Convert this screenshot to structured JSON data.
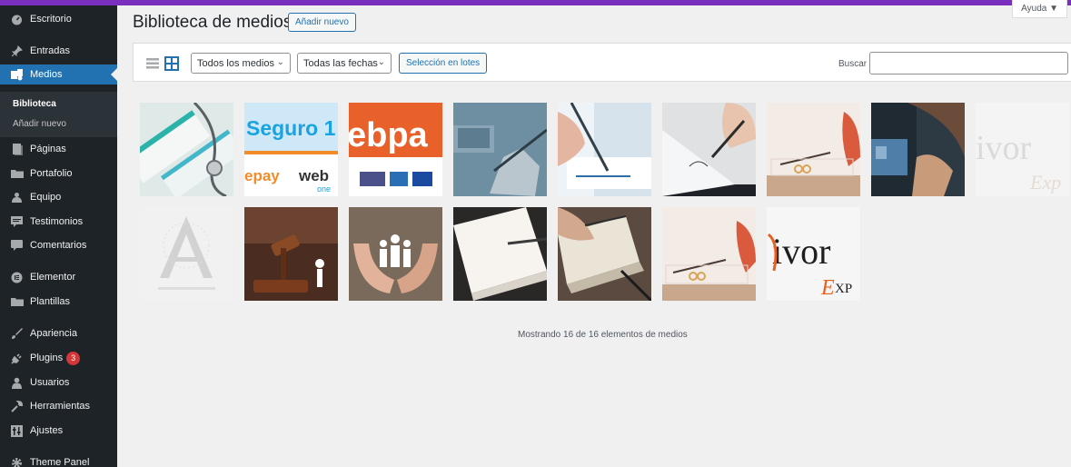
{
  "sidebar": {
    "items": [
      {
        "label": "Escritorio",
        "icon": "dashboard-icon"
      },
      {
        "label": "Entradas",
        "icon": "pin-icon"
      },
      {
        "label": "Medios",
        "icon": "media-icon"
      },
      {
        "label": "Páginas",
        "icon": "page-icon"
      },
      {
        "label": "Portafolio",
        "icon": "folder-icon"
      },
      {
        "label": "Equipo",
        "icon": "people-icon"
      },
      {
        "label": "Testimonios",
        "icon": "testimonial-icon"
      },
      {
        "label": "Comentarios",
        "icon": "comment-icon"
      },
      {
        "label": "Elementor",
        "icon": "elementor-icon"
      },
      {
        "label": "Plantillas",
        "icon": "folder-icon"
      },
      {
        "label": "Apariencia",
        "icon": "brush-icon"
      },
      {
        "label": "Plugins",
        "icon": "plug-icon",
        "badge": "3"
      },
      {
        "label": "Usuarios",
        "icon": "user-icon"
      },
      {
        "label": "Herramientas",
        "icon": "wrench-icon"
      },
      {
        "label": "Ajustes",
        "icon": "settings-icon"
      },
      {
        "label": "Theme Panel",
        "icon": "gear-icon"
      }
    ],
    "submenu": [
      "Biblioteca",
      "Añadir nuevo"
    ]
  },
  "header": {
    "title": "Biblioteca de medios",
    "add_new": "Añadir nuevo",
    "help": "Ayuda ▼"
  },
  "toolbar": {
    "filter_media": "Todos los medios",
    "filter_dates": "Todas las fechas",
    "bulk_select": "Selección en lotes",
    "search_label": "Buscar",
    "search_value": ""
  },
  "media_items": [
    {
      "type": "medical-cards"
    },
    {
      "type": "seguro-logo",
      "text": "Seguro 1"
    },
    {
      "type": "webpay-logo"
    },
    {
      "type": "laptop-writing"
    },
    {
      "type": "signing-document"
    },
    {
      "type": "signing-pen"
    },
    {
      "type": "rings-divorce"
    },
    {
      "type": "id-card-hand"
    },
    {
      "type": "divorce-logo-light",
      "text": "ivor"
    },
    {
      "type": "abogados-logo"
    },
    {
      "type": "gavel-family"
    },
    {
      "type": "hands-family"
    },
    {
      "type": "notebook-pen"
    },
    {
      "type": "notebook-writing"
    },
    {
      "type": "rings-divorce-2"
    },
    {
      "type": "divorce-logo",
      "text": "ivor"
    }
  ],
  "footer": {
    "count_text": "Mostrando 16 de 16 elementos de medios"
  },
  "colors": {
    "sidebar_bg": "#1d2327",
    "accent": "#2271b1",
    "top_bar": "#7a2fbe"
  }
}
